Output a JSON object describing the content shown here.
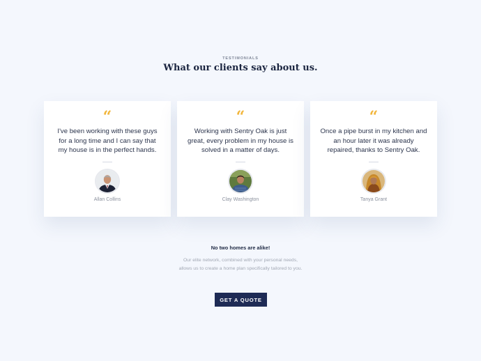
{
  "section": {
    "eyebrow": "TESTIMONIALS",
    "title": "What our clients say about us."
  },
  "testimonials": [
    {
      "quote_icon": "quote-icon",
      "text": "I've been working with these guys for a long time and I can say that my house is in the perfect hands.",
      "name": "Allan Collins",
      "avatar": "avatar-allan-collins"
    },
    {
      "quote_icon": "quote-icon",
      "text": "Working with Sentry Oak is just great, every problem in my house is solved in a matter of days.",
      "name": "Clay Washington",
      "avatar": "avatar-clay-washington"
    },
    {
      "quote_icon": "quote-icon",
      "text": "Once a pipe burst in my kitchen and an hour later it was already repaired, thanks to Sentry Oak.",
      "name": "Tanya Grant",
      "avatar": "avatar-tanya-grant"
    }
  ],
  "footer": {
    "tagline": "No two homes are alike!",
    "blurb": "Our elite network, combined with your personal needs, allows us to create a home plan specifically tailored to you.",
    "cta_label": "GET A QUOTE"
  },
  "colors": {
    "background": "#f4f7fd",
    "accent_quote": "#f2b63c",
    "cta_background": "#1e2b55",
    "heading": "#1b2540"
  }
}
